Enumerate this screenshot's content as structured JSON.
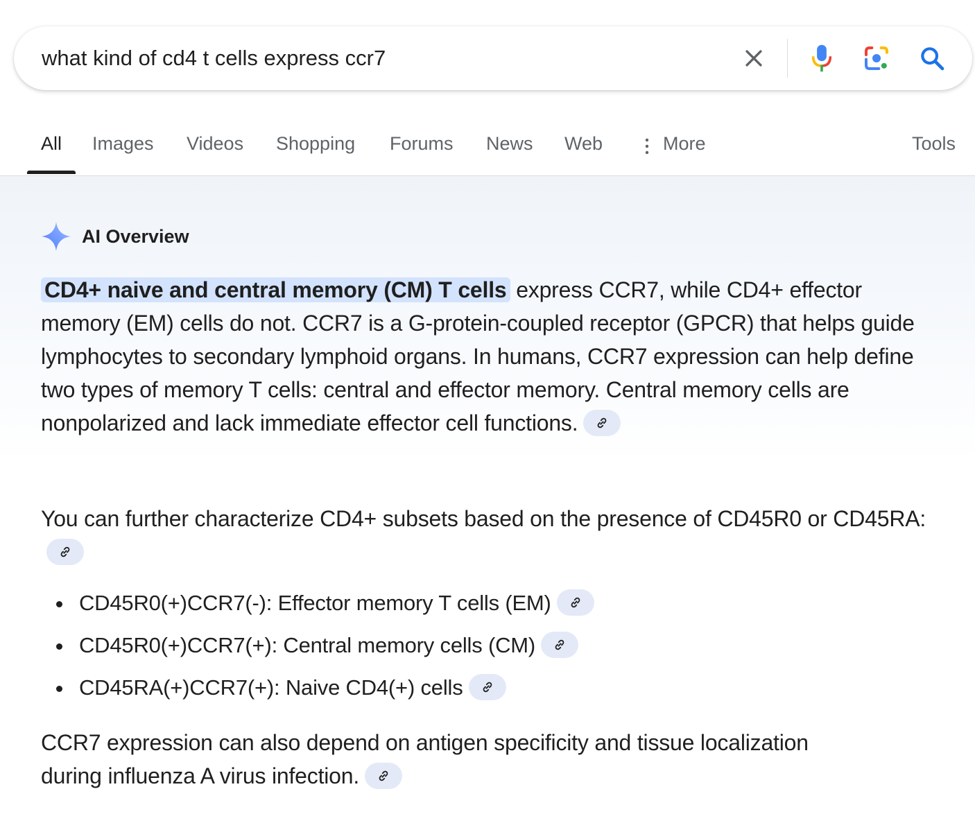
{
  "search": {
    "query": "what kind of cd4 t cells express ccr7",
    "clear_icon": "close-icon",
    "voice_icon": "microphone-icon",
    "lens_icon": "google-lens-icon",
    "search_icon": "search-icon"
  },
  "tabs": [
    {
      "label": "All",
      "active": true
    },
    {
      "label": "Images"
    },
    {
      "label": "Videos"
    },
    {
      "label": "Shopping"
    },
    {
      "label": "Forums"
    },
    {
      "label": "News"
    },
    {
      "label": "Web"
    },
    {
      "label": "More"
    },
    {
      "label": "Tools"
    }
  ],
  "ai_overview": {
    "title": "AI Overview",
    "p1_highlight": "CD4+ naive and central memory (CM) T cells",
    "p1_rest": " express CCR7, while CD4+ effector memory (EM) cells do not. CCR7 is a G-protein-coupled receptor (GPCR) that helps guide lymphocytes to secondary lymphoid organs. In humans, CCR7 expression can help define two types of memory T cells: central and effector memory. Central memory cells are nonpolarized and lack immediate effector cell functions.",
    "p2": "You can further characterize CD4+ subsets based on the presence of CD45R0 or CD45RA:",
    "bullets": [
      "CD45R0(+)CCR7(-): Effector memory T cells (EM)",
      "CD45R0(+)CCR7(+): Central memory cells (CM)",
      "CD45RA(+)CCR7(+): Naive CD4(+) cells"
    ],
    "p3": "CCR7 expression can also depend on antigen specificity and tissue localization during influenza A virus infection.",
    "link_icon": "link-icon"
  },
  "colors": {
    "highlight": "#d3e3fd",
    "chip": "#e3e9f7",
    "search_blue": "#1a73e8",
    "tab_inactive": "#5f6368"
  }
}
